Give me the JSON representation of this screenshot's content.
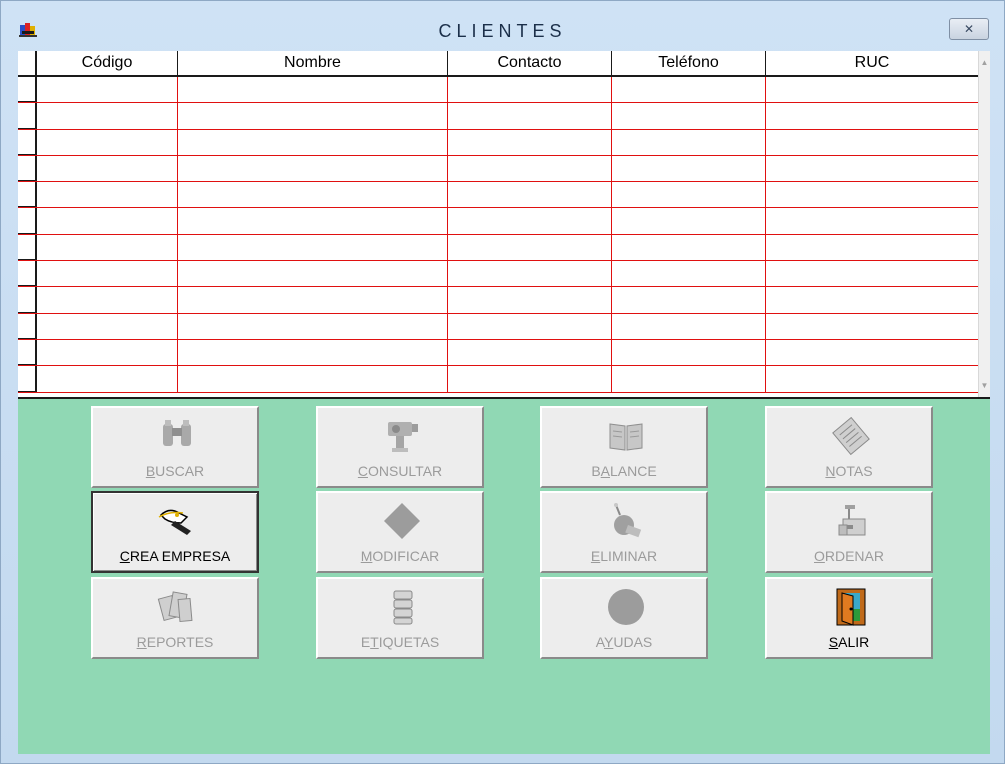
{
  "window": {
    "title": "CLIENTES",
    "close_glyph": "✕"
  },
  "colors": {
    "client_bg": "#90d8b4",
    "grid_line": "#e01010",
    "disabled_text": "#9b9b9b"
  },
  "grid": {
    "columns": [
      "Código",
      "Nombre",
      "Contacto",
      "Teléfono",
      "RUC"
    ],
    "row_count": 12
  },
  "buttons": [
    {
      "id": "buscar",
      "label": "BUSCAR",
      "accel": "B",
      "icon": "binoculars-icon",
      "enabled": false
    },
    {
      "id": "consultar",
      "label": "CONSULTAR",
      "accel": "C",
      "icon": "camera-icon",
      "enabled": false
    },
    {
      "id": "balance",
      "label": "BALANCE",
      "accel": "A",
      "icon": "book-icon",
      "enabled": false
    },
    {
      "id": "notas",
      "label": "NOTAS",
      "accel": "N",
      "icon": "notepad-icon",
      "enabled": false
    },
    {
      "id": "crea-empresa",
      "label": "CREA EMPRESA",
      "accel": "C",
      "icon": "pen-hand-icon",
      "enabled": true
    },
    {
      "id": "modificar",
      "label": "MODIFICAR",
      "accel": "M",
      "icon": "diamond-icon",
      "enabled": false
    },
    {
      "id": "eliminar",
      "label": "ELIMINAR",
      "accel": "E",
      "icon": "bomb-icon",
      "enabled": false
    },
    {
      "id": "ordenar",
      "label": "ORDENAR",
      "accel": "O",
      "icon": "machine-icon",
      "enabled": false
    },
    {
      "id": "reportes",
      "label": "REPORTES",
      "accel": "R",
      "icon": "papers-icon",
      "enabled": false
    },
    {
      "id": "etiquetas",
      "label": "ETIQUETAS",
      "accel": "T",
      "icon": "labels-icon",
      "enabled": false
    },
    {
      "id": "ayudas",
      "label": "AYUDAS",
      "accel": "Y",
      "icon": "circle-icon",
      "enabled": false
    },
    {
      "id": "salir",
      "label": "SALIR",
      "accel": "S",
      "icon": "exit-door-icon",
      "enabled": true
    }
  ]
}
